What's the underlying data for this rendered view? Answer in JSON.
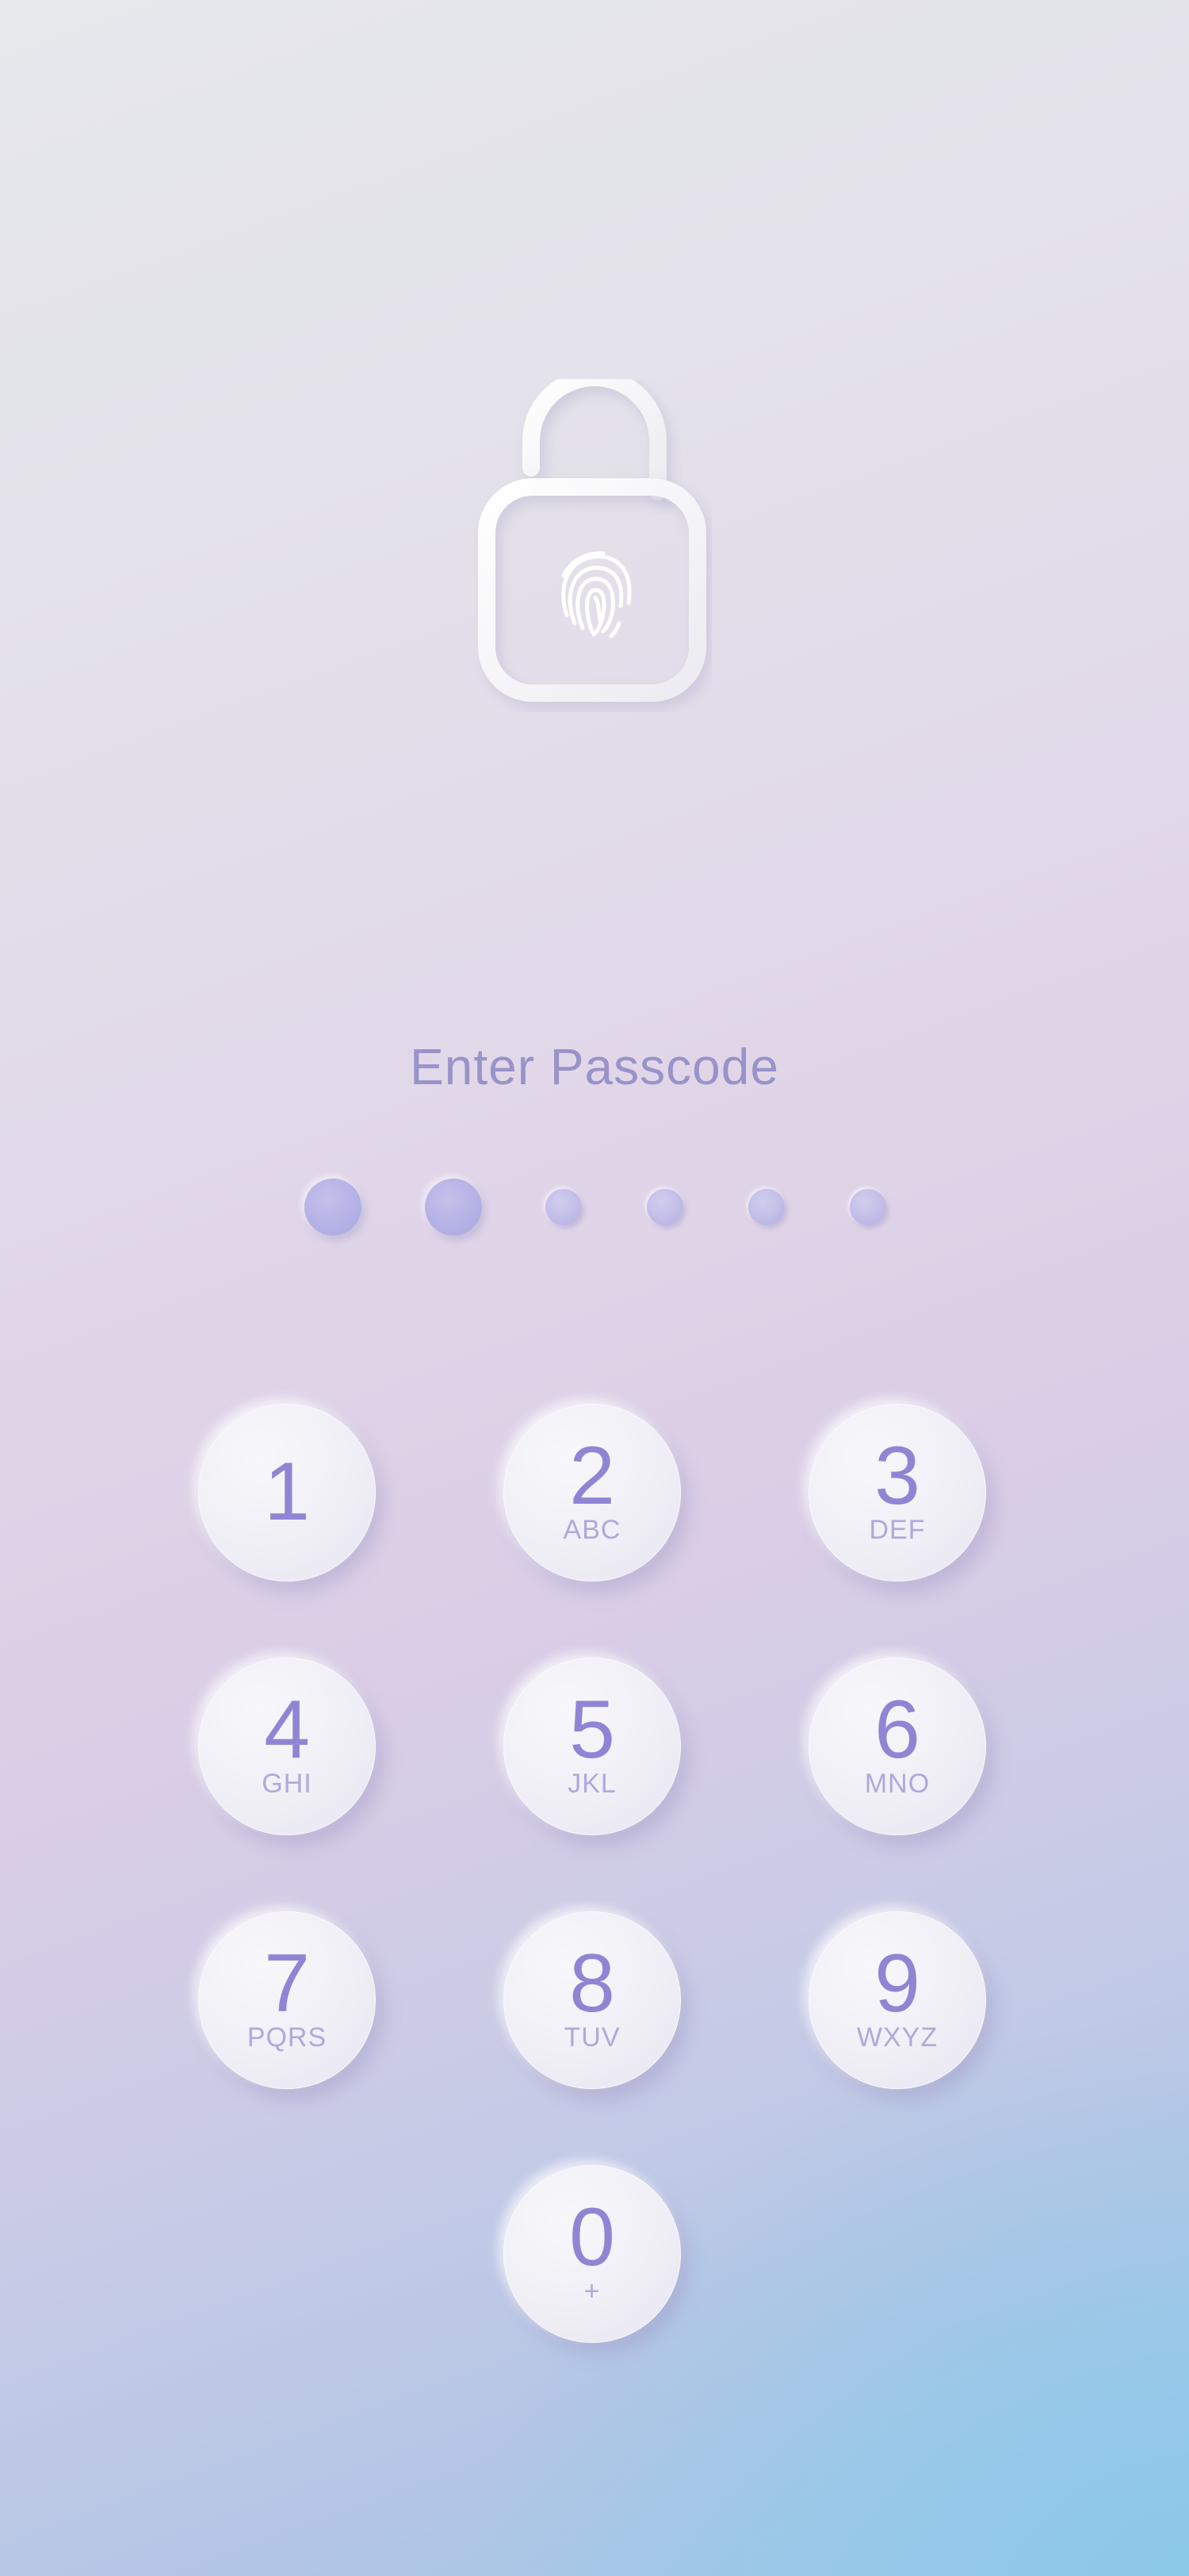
{
  "title": "Enter Passcode",
  "passcode": {
    "length": 6,
    "filled": 2
  },
  "lock_icon": "lock-fingerprint-icon",
  "colors": {
    "accent": "#8f85d4",
    "title": "#9893c8",
    "letters": "#b0a8dc",
    "dot": "#b4b2e6"
  },
  "keypad": [
    {
      "digit": "1",
      "letters": ""
    },
    {
      "digit": "2",
      "letters": "ABC"
    },
    {
      "digit": "3",
      "letters": "DEF"
    },
    {
      "digit": "4",
      "letters": "GHI"
    },
    {
      "digit": "5",
      "letters": "JKL"
    },
    {
      "digit": "6",
      "letters": "MNO"
    },
    {
      "digit": "7",
      "letters": "PQRS"
    },
    {
      "digit": "8",
      "letters": "TUV"
    },
    {
      "digit": "9",
      "letters": "WXYZ"
    },
    {
      "digit": "0",
      "letters": "+"
    }
  ]
}
